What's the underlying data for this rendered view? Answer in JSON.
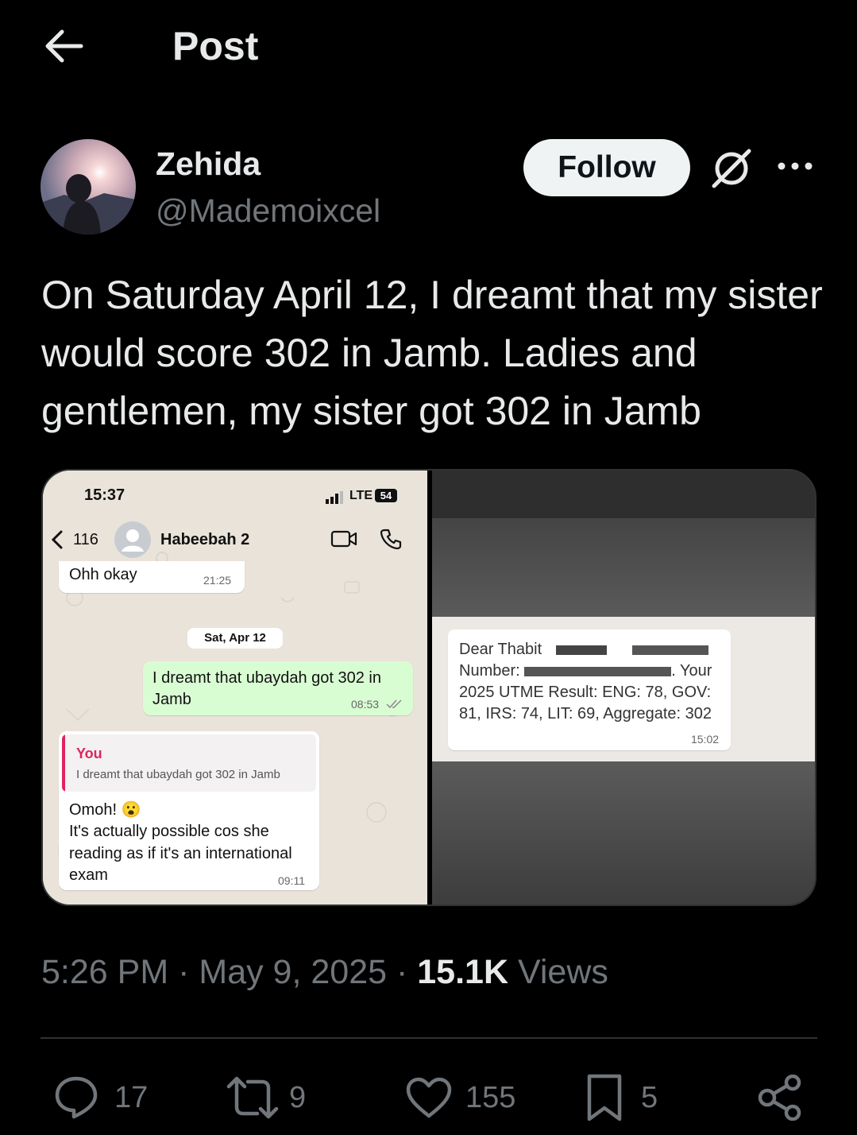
{
  "header": {
    "title": "Post"
  },
  "author": {
    "name": "Zehida",
    "handle": "@Mademoixcel",
    "follow_label": "Follow"
  },
  "tweet": {
    "text": "On Saturday April 12, I dreamt that my sister would score 302 in Jamb. Ladies and gentlemen, my sister got 302 in Jamb"
  },
  "media": {
    "chat": {
      "status_time": "15:37",
      "network": "LTE",
      "battery": "54",
      "back_count": "116",
      "contact": "Habeebah 2",
      "msg1": {
        "text": "Ohh okay",
        "time": "21:25"
      },
      "date_chip": "Sat, Apr 12",
      "msg2": {
        "text": "I dreamt that ubaydah got 302 in Jamb",
        "time": "08:53"
      },
      "reply": {
        "quote_author": "You",
        "quote_text": "I dreamt that ubaydah got 302 in Jamb",
        "line1": "Omoh! 😮",
        "line2": "It's actually possible cos she reading as if it's an international exam",
        "time": "09:11"
      }
    },
    "sms": {
      "line1": "Dear Thabit",
      "line2": "Number:",
      "line2b": ". Your",
      "line3": "2025 UTME Result: ENG: 78, GOV: 81, IRS: 74, LIT: 69, Aggregate: 302",
      "time": "15:02"
    }
  },
  "meta": {
    "time": "5:26 PM",
    "sep1": "·",
    "date": "May 9, 2025",
    "sep2": "·",
    "views_count": "15.1K",
    "views_label": "Views"
  },
  "actions": {
    "replies": "17",
    "reposts": "9",
    "likes": "155",
    "bookmarks": "5"
  },
  "colors": {
    "background": "#000000",
    "text": "#e7e9ea",
    "muted": "#71767b",
    "chat_green": "#d9fdd3",
    "reply_bar": "#e0245e"
  }
}
